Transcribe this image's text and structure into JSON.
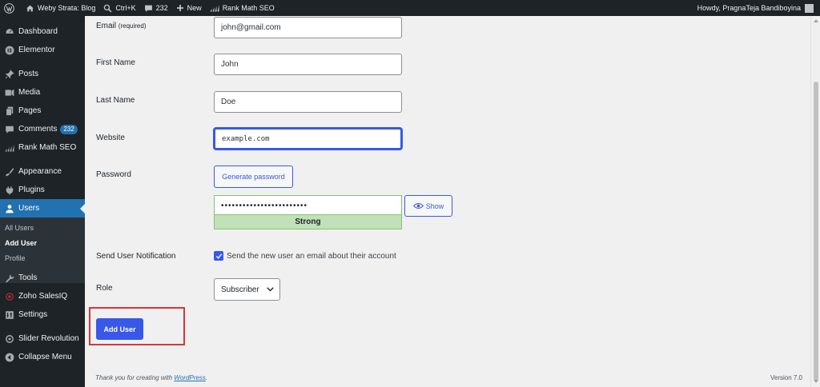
{
  "adminbar": {
    "site_name": "Weby Strata: Blog",
    "command": "Ctrl+K",
    "comments_count": "232",
    "new_label": "New",
    "rankmath_label": "Rank Math SEO",
    "howdy": "Howdy, PragnaTeja Bandiboyina"
  },
  "sidebar": {
    "items": [
      {
        "label": "Dashboard",
        "icon": "dashboard-icon"
      },
      {
        "label": "Elementor",
        "icon": "elementor-icon"
      },
      {
        "label": "Posts",
        "icon": "pin-icon"
      },
      {
        "label": "Media",
        "icon": "media-icon"
      },
      {
        "label": "Pages",
        "icon": "pages-icon"
      },
      {
        "label": "Comments",
        "icon": "comment-icon",
        "badge": "232"
      },
      {
        "label": "Rank Math SEO",
        "icon": "chart-icon"
      },
      {
        "label": "Appearance",
        "icon": "brush-icon"
      },
      {
        "label": "Plugins",
        "icon": "plug-icon"
      },
      {
        "label": "Users",
        "icon": "user-icon"
      },
      {
        "label": "Tools",
        "icon": "wrench-icon"
      },
      {
        "label": "Zoho SalesIQ",
        "icon": "zoho-icon"
      },
      {
        "label": "Settings",
        "icon": "settings-icon"
      },
      {
        "label": "Slider Revolution",
        "icon": "slider-icon"
      },
      {
        "label": "Collapse Menu",
        "icon": "collapse-icon"
      }
    ],
    "submenu": [
      "All Users",
      "Add User",
      "Profile"
    ]
  },
  "form": {
    "email_label": "Email",
    "email_required": "(required)",
    "email_value": "john@gmail.com",
    "first_name_label": "First Name",
    "first_name_value": "John",
    "last_name_label": "Last Name",
    "last_name_value": "Doe",
    "website_label": "Website",
    "website_value": "example.com",
    "password_label": "Password",
    "generate_password": "Generate password",
    "password_mask": "••••••••••••••••••••••••",
    "show_label": "Show",
    "strength": "Strong",
    "notification_label": "Send User Notification",
    "notification_text": "Send the new user an email about their account",
    "role_label": "Role",
    "role_value": "Subscriber",
    "submit": "Add User"
  },
  "footer": {
    "thanks_prefix": "Thank you for creating with ",
    "thanks_link": "WordPress",
    "thanks_suffix": ".",
    "version": "Version 7.0"
  },
  "colors": {
    "accent": "#3858e9",
    "adminbar_bg": "#1d2327",
    "active_menu": "#2271b1",
    "highlight_box": "#d63638",
    "strength_bg": "#c1e1b9"
  }
}
